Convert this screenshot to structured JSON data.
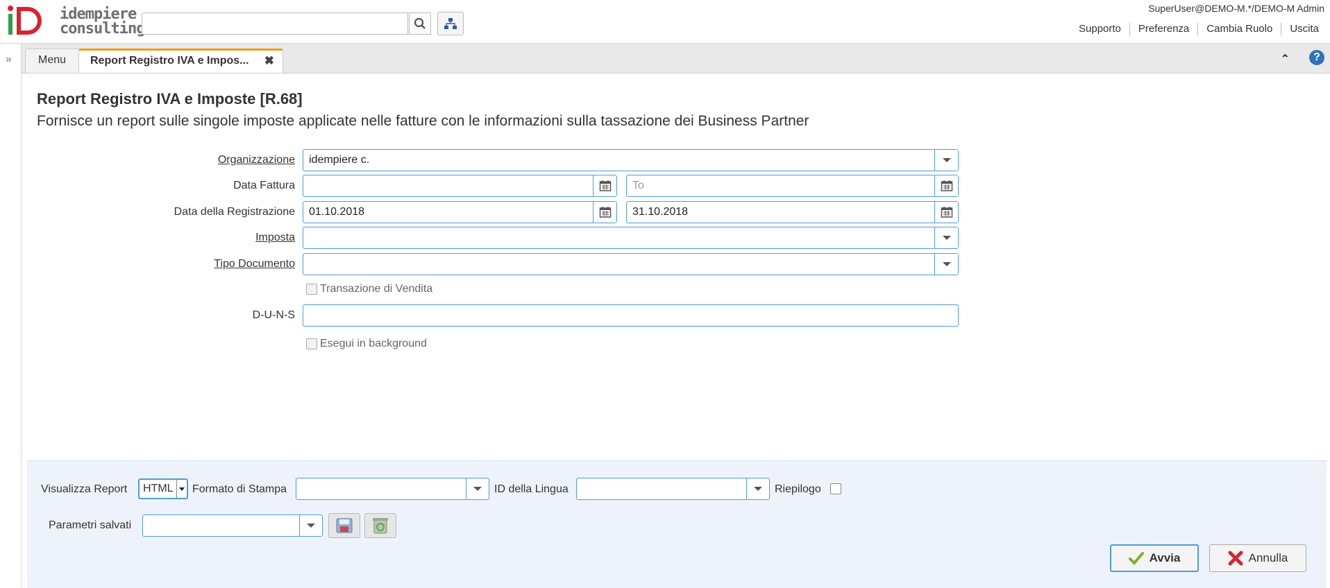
{
  "header": {
    "logo_text_line1": "idempiere",
    "logo_text_line2": "consulting",
    "search_placeholder": "",
    "user_label": "SuperUser@DEMO-M.*/DEMO-M Admin",
    "links": [
      "Supporto",
      "Preferenza",
      "Cambia Ruolo",
      "Uscita"
    ]
  },
  "tabs": {
    "menu_label": "Menu",
    "active_label": "Report Registro IVA e Impos...",
    "close_glyph": "✖"
  },
  "form": {
    "title": "Report Registro IVA e Imposte [R.68]",
    "description": "Fornisce un report sulle singole imposte applicate nelle fatture con le informazioni sulla tassazione dei Business Partner",
    "organizzazione": {
      "label": "Organizzazione",
      "value": "idempiere c."
    },
    "data_fattura": {
      "label": "Data Fattura",
      "from": "",
      "to_placeholder": "To"
    },
    "data_registrazione": {
      "label": "Data della Registrazione",
      "from": "01.10.2018",
      "to": "31.10.2018"
    },
    "imposta": {
      "label": "Imposta",
      "value": ""
    },
    "tipo_documento": {
      "label": "Tipo Documento",
      "value": ""
    },
    "transazione_vendita": {
      "label": "Transazione di Vendita",
      "checked": false
    },
    "duns": {
      "label": "D-U-N-S",
      "value": ""
    },
    "background": {
      "label": "Esegui in background",
      "checked": false
    }
  },
  "bottom": {
    "visualizza_label": "Visualizza Report",
    "visualizza_value": "HTML",
    "formato_label": "Formato di Stampa",
    "formato_value": "",
    "lingua_label": "ID della Lingua",
    "lingua_value": "",
    "riepilogo_label": "Riepilogo",
    "riepilogo_checked": false,
    "parametri_label": "Parametri salvati",
    "parametri_value": "",
    "avvia_label": "Avvia",
    "annulla_label": "Annulla"
  },
  "icons": [
    "search-icon",
    "tree-icon",
    "calendar-icon",
    "dropdown-caret-icon",
    "save-icon",
    "recycle-icon",
    "check-icon",
    "cancel-icon",
    "help-icon",
    "collapse-icon",
    "expand-west-icon"
  ],
  "colors": {
    "accent": "#4c9ed9",
    "tab_highlight": "#f39c12",
    "help": "#2e73b8",
    "logo_red": "#d9232d",
    "logo_green": "#2aa147"
  }
}
